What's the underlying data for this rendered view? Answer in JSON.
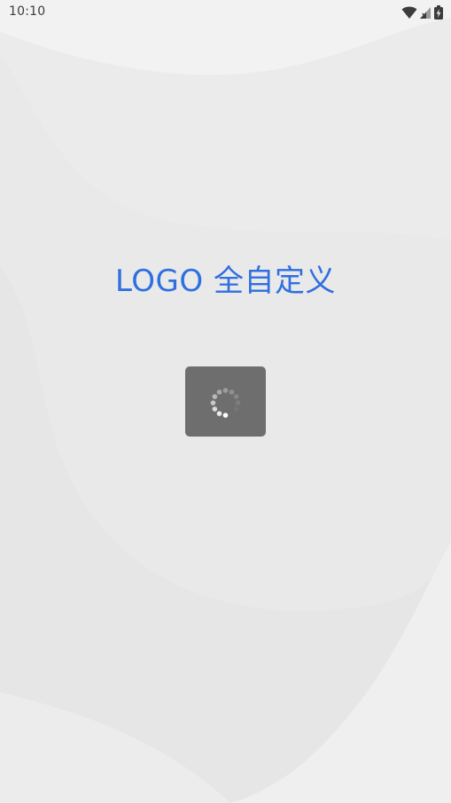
{
  "status_bar": {
    "time": "10:10",
    "icons": [
      "wifi-icon",
      "cell-signal-icon",
      "battery-charging-icon"
    ]
  },
  "splash": {
    "logo_text": "LOGO 全自定义"
  },
  "loading": {
    "icon": "loading-spinner-icon"
  },
  "colors": {
    "background": "#ebebeb",
    "logo_text": "#2f6fe0",
    "loading_box": "#6e6e6e",
    "status_text": "#3c3c3c"
  }
}
